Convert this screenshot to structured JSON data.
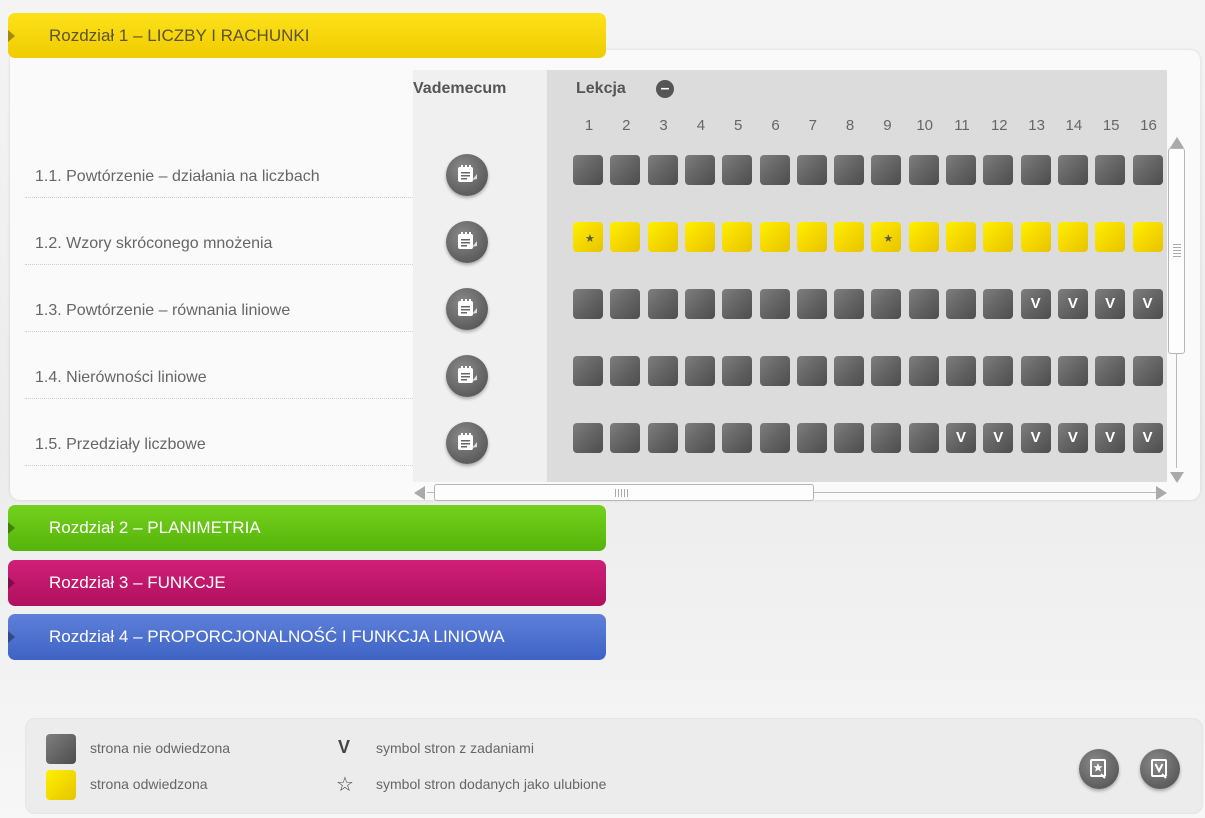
{
  "chapters": [
    {
      "label": "Rozdział 1 – LICZBY I RACHUNKI",
      "color": "#f7d70b"
    },
    {
      "label": "Rozdział 2 – PLANIMETRIA",
      "color": "#64c214"
    },
    {
      "label": "Rozdział 3 – FUNKCJE",
      "color": "#c0186a"
    },
    {
      "label": "Rozdział 4 – PROPORCJONALNOŚĆ I FUNKCJA LINIOWA",
      "color": "#4f72cf"
    }
  ],
  "columns": {
    "vademecum": "Vademecum",
    "lesson": "Lekcja",
    "lesson_numbers": [
      "1",
      "2",
      "3",
      "4",
      "5",
      "6",
      "7",
      "8",
      "9",
      "10",
      "11",
      "12",
      "13",
      "14",
      "15",
      "16"
    ]
  },
  "rows": [
    {
      "title": "1.1. Powtórzenie – działania na liczbach",
      "cells": [
        "u",
        "u",
        "u",
        "u",
        "u",
        "u",
        "u",
        "u",
        "u",
        "u",
        "u",
        "u",
        "u",
        "u",
        "u",
        "u"
      ]
    },
    {
      "title": "1.2. Wzory skróconego mnożenia",
      "cells": [
        "v*",
        "v",
        "v",
        "v",
        "v",
        "v",
        "v",
        "v",
        "v*",
        "v",
        "v",
        "v",
        "v",
        "v",
        "v",
        "v"
      ]
    },
    {
      "title": "1.3. Powtórzenie – równania liniowe",
      "cells": [
        "u",
        "u",
        "u",
        "u",
        "u",
        "u",
        "u",
        "u",
        "u",
        "u",
        "u",
        "u",
        "uV",
        "uV",
        "uV",
        "uV"
      ]
    },
    {
      "title": "1.4. Nierówności liniowe",
      "cells": [
        "u",
        "u",
        "u",
        "u",
        "u",
        "u",
        "u",
        "u",
        "u",
        "u",
        "u",
        "u",
        "u",
        "u",
        "u",
        "u"
      ]
    },
    {
      "title": "1.5. Przedziały liczbowe",
      "cells": [
        "u",
        "u",
        "u",
        "u",
        "u",
        "u",
        "u",
        "u",
        "u",
        "u",
        "uV",
        "uV",
        "uV",
        "uV",
        "uV",
        "uV"
      ]
    }
  ],
  "task_symbol": "V",
  "favorite_symbol": "★",
  "legend": {
    "not_visited": "strona nie odwiedzona",
    "visited": "strona odwiedzona",
    "task_symbol": "V",
    "task_text": "symbol stron z zadaniami",
    "fav_symbol": "☆",
    "fav_text": "symbol stron dodanych jako ulubione"
  },
  "colors": {
    "unvisited": "#666666",
    "visited": "#f5d800"
  },
  "icons": {
    "vademecum": "notepad-icon",
    "favorites_button": "favorites-icon",
    "tasks_button": "tasks-icon"
  }
}
